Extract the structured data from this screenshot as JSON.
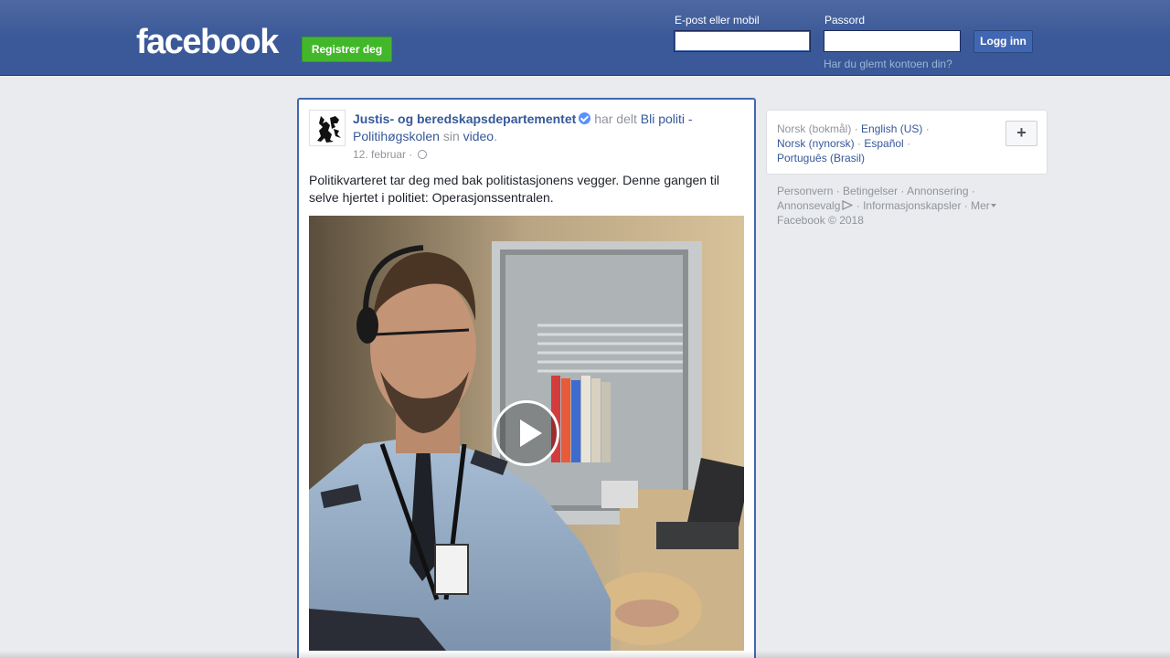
{
  "header": {
    "logo": "facebook",
    "register_label": "Registrer deg",
    "email_label": "E-post eller mobil",
    "password_label": "Passord",
    "email_value": "",
    "password_value": "",
    "login_label": "Logg inn",
    "forgot_label": "Har du glemt kontoen din?"
  },
  "post": {
    "author": "Justis- og beredskapsdepartementet",
    "verified": true,
    "shared_text": "har delt",
    "shared_page": "Bli politi - Politihøgskolen",
    "sin_text": "sin",
    "shared_type": "video",
    "period": ".",
    "date": "12. februar",
    "separator": "·",
    "body": "Politikvarteret tar deg med bak politistasjonens vegger. Denne gangen til selve hjertet i politiet: Operasjonssentralen."
  },
  "languages": {
    "current": "Norsk (bokmål)",
    "options": [
      "English (US)",
      "Norsk (nynorsk)",
      "Español",
      "Português (Brasil)"
    ],
    "more_label": "+"
  },
  "footer": {
    "links": [
      "Personvern",
      "Betingelser",
      "Annonsering",
      "Annonsevalg",
      "Informasjonskapsler",
      "Mer"
    ],
    "copyright": "Facebook © 2018"
  }
}
